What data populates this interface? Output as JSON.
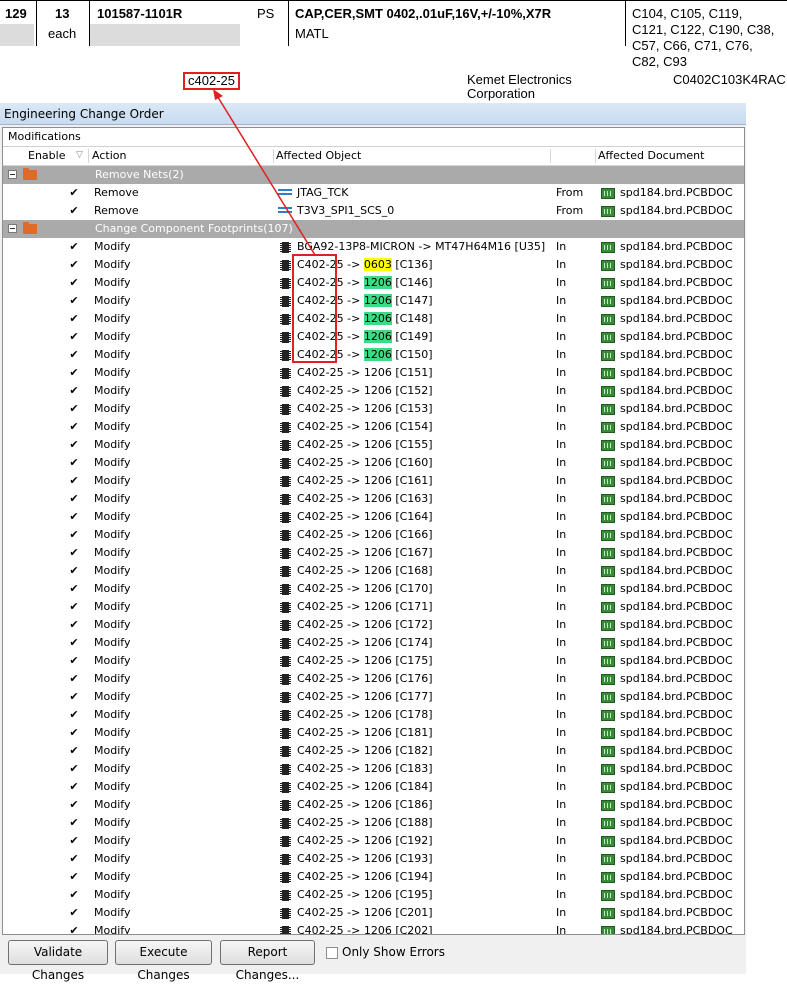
{
  "bom": {
    "line": "129",
    "qty": "13",
    "unit": "each",
    "part_number": "101587-1101R",
    "type": "PS",
    "description": "CAP,CER,SMT 0402,.01uF,16V,+/-10%,X7R",
    "category": "MATL",
    "refdes_lines": [
      "C104, C105, C119,",
      "C121, C122, C190, C38,",
      "C57, C66, C71, C76,",
      "C82, C93"
    ],
    "footprint": "c402-25",
    "manufacturer_lines": [
      "Kemet Electronics",
      "Corporation"
    ],
    "mfr_part": "C0402C103K4RAC"
  },
  "eco": {
    "title": "Engineering Change Order",
    "section": "Modifications",
    "columns": {
      "enable": "Enable",
      "sort_glyph": "▽",
      "action": "Action",
      "object": "Affected Object",
      "document": "Affected Document"
    },
    "groups": [
      {
        "label": "Remove Nets(2)",
        "rows": [
          {
            "action": "Remove",
            "icon": "net-icon",
            "pre": "JTAG_TCK",
            "hl": "",
            "post": "",
            "dir": "From",
            "doc": "spd184.brd.PCBDOC"
          },
          {
            "action": "Remove",
            "icon": "net-icon",
            "pre": "T3V3_SPI1_SCS_0",
            "hl": "",
            "post": "",
            "dir": "From",
            "doc": "spd184.brd.PCBDOC"
          }
        ]
      },
      {
        "label": "Change Component Footprints(107)",
        "rows": [
          {
            "action": "Modify",
            "icon": "component-icon",
            "pre": "BGA92-13P8-MICRON -> MT47H64M16 [U35]",
            "hl": "",
            "post": "",
            "dir": "In",
            "doc": "spd184.brd.PCBDOC"
          },
          {
            "action": "Modify",
            "icon": "component-icon",
            "pre": "C402-25 -> ",
            "hl": "0603",
            "hlc": "yellow",
            "post": " [C136]",
            "dir": "In",
            "doc": "spd184.brd.PCBDOC"
          },
          {
            "action": "Modify",
            "icon": "component-icon",
            "pre": "C402-25 -> ",
            "hl": "1206",
            "hlc": "green",
            "post": " [C146]",
            "dir": "In",
            "doc": "spd184.brd.PCBDOC"
          },
          {
            "action": "Modify",
            "icon": "component-icon",
            "pre": "C402-25 -> ",
            "hl": "1206",
            "hlc": "green",
            "post": " [C147]",
            "dir": "In",
            "doc": "spd184.brd.PCBDOC"
          },
          {
            "action": "Modify",
            "icon": "component-icon",
            "pre": "C402-25 -> ",
            "hl": "1206",
            "hlc": "green",
            "post": " [C148]",
            "dir": "In",
            "doc": "spd184.brd.PCBDOC"
          },
          {
            "action": "Modify",
            "icon": "component-icon",
            "pre": "C402-25 -> ",
            "hl": "1206",
            "hlc": "green",
            "post": " [C149]",
            "dir": "In",
            "doc": "spd184.brd.PCBDOC"
          },
          {
            "action": "Modify",
            "icon": "component-icon",
            "pre": "C402-25 -> ",
            "hl": "1206",
            "hlc": "green",
            "post": " [C150]",
            "dir": "In",
            "doc": "spd184.brd.PCBDOC"
          },
          {
            "action": "Modify",
            "icon": "component-icon",
            "pre": "C402-25 -> 1206 [C151]",
            "hl": "",
            "post": "",
            "dir": "In",
            "doc": "spd184.brd.PCBDOC"
          },
          {
            "action": "Modify",
            "icon": "component-icon",
            "pre": "C402-25 -> 1206 [C152]",
            "hl": "",
            "post": "",
            "dir": "In",
            "doc": "spd184.brd.PCBDOC"
          },
          {
            "action": "Modify",
            "icon": "component-icon",
            "pre": "C402-25 -> 1206 [C153]",
            "hl": "",
            "post": "",
            "dir": "In",
            "doc": "spd184.brd.PCBDOC"
          },
          {
            "action": "Modify",
            "icon": "component-icon",
            "pre": "C402-25 -> 1206 [C154]",
            "hl": "",
            "post": "",
            "dir": "In",
            "doc": "spd184.brd.PCBDOC"
          },
          {
            "action": "Modify",
            "icon": "component-icon",
            "pre": "C402-25 -> 1206 [C155]",
            "hl": "",
            "post": "",
            "dir": "In",
            "doc": "spd184.brd.PCBDOC"
          },
          {
            "action": "Modify",
            "icon": "component-icon",
            "pre": "C402-25 -> 1206 [C160]",
            "hl": "",
            "post": "",
            "dir": "In",
            "doc": "spd184.brd.PCBDOC"
          },
          {
            "action": "Modify",
            "icon": "component-icon",
            "pre": "C402-25 -> 1206 [C161]",
            "hl": "",
            "post": "",
            "dir": "In",
            "doc": "spd184.brd.PCBDOC"
          },
          {
            "action": "Modify",
            "icon": "component-icon",
            "pre": "C402-25 -> 1206 [C163]",
            "hl": "",
            "post": "",
            "dir": "In",
            "doc": "spd184.brd.PCBDOC"
          },
          {
            "action": "Modify",
            "icon": "component-icon",
            "pre": "C402-25 -> 1206 [C164]",
            "hl": "",
            "post": "",
            "dir": "In",
            "doc": "spd184.brd.PCBDOC"
          },
          {
            "action": "Modify",
            "icon": "component-icon",
            "pre": "C402-25 -> 1206 [C166]",
            "hl": "",
            "post": "",
            "dir": "In",
            "doc": "spd184.brd.PCBDOC"
          },
          {
            "action": "Modify",
            "icon": "component-icon",
            "pre": "C402-25 -> 1206 [C167]",
            "hl": "",
            "post": "",
            "dir": "In",
            "doc": "spd184.brd.PCBDOC"
          },
          {
            "action": "Modify",
            "icon": "component-icon",
            "pre": "C402-25 -> 1206 [C168]",
            "hl": "",
            "post": "",
            "dir": "In",
            "doc": "spd184.brd.PCBDOC"
          },
          {
            "action": "Modify",
            "icon": "component-icon",
            "pre": "C402-25 -> 1206 [C170]",
            "hl": "",
            "post": "",
            "dir": "In",
            "doc": "spd184.brd.PCBDOC"
          },
          {
            "action": "Modify",
            "icon": "component-icon",
            "pre": "C402-25 -> 1206 [C171]",
            "hl": "",
            "post": "",
            "dir": "In",
            "doc": "spd184.brd.PCBDOC"
          },
          {
            "action": "Modify",
            "icon": "component-icon",
            "pre": "C402-25 -> 1206 [C172]",
            "hl": "",
            "post": "",
            "dir": "In",
            "doc": "spd184.brd.PCBDOC"
          },
          {
            "action": "Modify",
            "icon": "component-icon",
            "pre": "C402-25 -> 1206 [C174]",
            "hl": "",
            "post": "",
            "dir": "In",
            "doc": "spd184.brd.PCBDOC"
          },
          {
            "action": "Modify",
            "icon": "component-icon",
            "pre": "C402-25 -> 1206 [C175]",
            "hl": "",
            "post": "",
            "dir": "In",
            "doc": "spd184.brd.PCBDOC"
          },
          {
            "action": "Modify",
            "icon": "component-icon",
            "pre": "C402-25 -> 1206 [C176]",
            "hl": "",
            "post": "",
            "dir": "In",
            "doc": "spd184.brd.PCBDOC"
          },
          {
            "action": "Modify",
            "icon": "component-icon",
            "pre": "C402-25 -> 1206 [C177]",
            "hl": "",
            "post": "",
            "dir": "In",
            "doc": "spd184.brd.PCBDOC"
          },
          {
            "action": "Modify",
            "icon": "component-icon",
            "pre": "C402-25 -> 1206 [C178]",
            "hl": "",
            "post": "",
            "dir": "In",
            "doc": "spd184.brd.PCBDOC"
          },
          {
            "action": "Modify",
            "icon": "component-icon",
            "pre": "C402-25 -> 1206 [C181]",
            "hl": "",
            "post": "",
            "dir": "In",
            "doc": "spd184.brd.PCBDOC"
          },
          {
            "action": "Modify",
            "icon": "component-icon",
            "pre": "C402-25 -> 1206 [C182]",
            "hl": "",
            "post": "",
            "dir": "In",
            "doc": "spd184.brd.PCBDOC"
          },
          {
            "action": "Modify",
            "icon": "component-icon",
            "pre": "C402-25 -> 1206 [C183]",
            "hl": "",
            "post": "",
            "dir": "In",
            "doc": "spd184.brd.PCBDOC"
          },
          {
            "action": "Modify",
            "icon": "component-icon",
            "pre": "C402-25 -> 1206 [C184]",
            "hl": "",
            "post": "",
            "dir": "In",
            "doc": "spd184.brd.PCBDOC"
          },
          {
            "action": "Modify",
            "icon": "component-icon",
            "pre": "C402-25 -> 1206 [C186]",
            "hl": "",
            "post": "",
            "dir": "In",
            "doc": "spd184.brd.PCBDOC"
          },
          {
            "action": "Modify",
            "icon": "component-icon",
            "pre": "C402-25 -> 1206 [C188]",
            "hl": "",
            "post": "",
            "dir": "In",
            "doc": "spd184.brd.PCBDOC"
          },
          {
            "action": "Modify",
            "icon": "component-icon",
            "pre": "C402-25 -> 1206 [C192]",
            "hl": "",
            "post": "",
            "dir": "In",
            "doc": "spd184.brd.PCBDOC"
          },
          {
            "action": "Modify",
            "icon": "component-icon",
            "pre": "C402-25 -> 1206 [C193]",
            "hl": "",
            "post": "",
            "dir": "In",
            "doc": "spd184.brd.PCBDOC"
          },
          {
            "action": "Modify",
            "icon": "component-icon",
            "pre": "C402-25 -> 1206 [C194]",
            "hl": "",
            "post": "",
            "dir": "In",
            "doc": "spd184.brd.PCBDOC"
          },
          {
            "action": "Modify",
            "icon": "component-icon",
            "pre": "C402-25 -> 1206 [C195]",
            "hl": "",
            "post": "",
            "dir": "In",
            "doc": "spd184.brd.PCBDOC"
          },
          {
            "action": "Modify",
            "icon": "component-icon",
            "pre": "C402-25 -> 1206 [C201]",
            "hl": "",
            "post": "",
            "dir": "In",
            "doc": "spd184.brd.PCBDOC"
          },
          {
            "action": "Modify",
            "icon": "component-icon",
            "pre": "C402-25 -> 1206 [C202]",
            "hl": "",
            "post": "",
            "dir": "In",
            "doc": "spd184.brd.PCBDOC"
          }
        ]
      }
    ],
    "buttons": {
      "validate": "Validate Changes",
      "execute": "Execute Changes",
      "report": "Report Changes...",
      "only_errors": "Only Show Errors"
    }
  },
  "colors": {
    "highlight_yellow": "#ffff00",
    "highlight_green": "#3ddc84",
    "annotation_red": "#e02020",
    "group_gray": "#aaaaaa"
  }
}
